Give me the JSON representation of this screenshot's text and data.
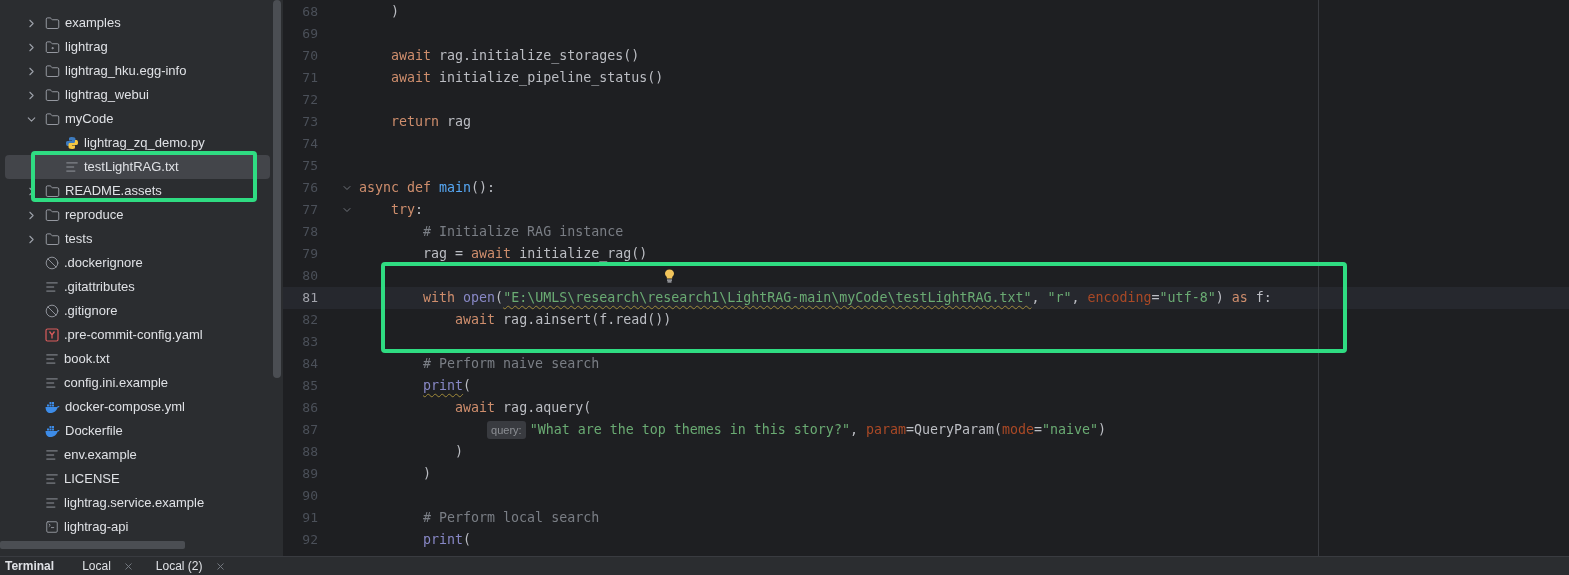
{
  "project_tree": [
    {
      "name": "examples",
      "kind": "folder",
      "expanded": false,
      "selected": false
    },
    {
      "name": "lightrag",
      "kind": "package",
      "expanded": false,
      "selected": false
    },
    {
      "name": "lightrag_hku.egg-info",
      "kind": "folder",
      "expanded": false,
      "selected": false
    },
    {
      "name": "lightrag_webui",
      "kind": "folder",
      "expanded": false,
      "selected": false
    },
    {
      "name": "myCode",
      "kind": "folder",
      "expanded": true,
      "selected": false,
      "children": [
        {
          "name": "lightrag_zq_demo.py",
          "kind": "python",
          "selected": false
        },
        {
          "name": "testLightRAG.txt",
          "kind": "text",
          "selected": true
        }
      ]
    },
    {
      "name": "README.assets",
      "kind": "folder",
      "expanded": false,
      "selected": false
    },
    {
      "name": "reproduce",
      "kind": "folder",
      "expanded": false,
      "selected": false
    },
    {
      "name": "tests",
      "kind": "folder",
      "expanded": false,
      "selected": false
    },
    {
      "name": ".dockerignore",
      "kind": "ignore",
      "selected": false
    },
    {
      "name": ".gitattributes",
      "kind": "text",
      "selected": false
    },
    {
      "name": ".gitignore",
      "kind": "ignore",
      "selected": false
    },
    {
      "name": ".pre-commit-config.yaml",
      "kind": "yaml",
      "selected": false
    },
    {
      "name": "book.txt",
      "kind": "text",
      "selected": false
    },
    {
      "name": "config.ini.example",
      "kind": "text",
      "selected": false
    },
    {
      "name": "docker-compose.yml",
      "kind": "docker",
      "selected": false
    },
    {
      "name": "Dockerfile",
      "kind": "docker",
      "selected": false
    },
    {
      "name": "env.example",
      "kind": "text",
      "selected": false
    },
    {
      "name": "LICENSE",
      "kind": "text",
      "selected": false
    },
    {
      "name": "lightrag.service.example",
      "kind": "text",
      "selected": false
    },
    {
      "name": "lightrag-api",
      "kind": "terminal",
      "selected": false
    }
  ],
  "editor": {
    "lines": [
      {
        "number": "68",
        "current": false,
        "fold": false,
        "bulb": false,
        "tokens": [
          {
            "kind": "plain",
            "text": "    )"
          }
        ]
      },
      {
        "number": "69",
        "current": false,
        "fold": false,
        "bulb": false
      },
      {
        "number": "70",
        "current": false,
        "fold": false,
        "bulb": false,
        "tokens": [
          {
            "kind": "keyword",
            "text": "    await"
          },
          {
            "kind": "plain",
            "text": " rag.initialize_storages()"
          }
        ]
      },
      {
        "number": "71",
        "current": false,
        "fold": false,
        "bulb": false,
        "tokens": [
          {
            "kind": "keyword",
            "text": "    await"
          },
          {
            "kind": "plain",
            "text": " initialize_pipeline_status()"
          }
        ]
      },
      {
        "number": "72",
        "current": false,
        "fold": false,
        "bulb": false
      },
      {
        "number": "73",
        "current": false,
        "fold": false,
        "bulb": false,
        "tokens": [
          {
            "kind": "keyword",
            "text": "    return"
          },
          {
            "kind": "plain",
            "text": " rag"
          }
        ]
      },
      {
        "number": "74",
        "current": false,
        "fold": false,
        "bulb": false
      },
      {
        "number": "75",
        "current": false,
        "fold": false,
        "bulb": false
      },
      {
        "number": "76",
        "current": false,
        "fold": true,
        "bulb": false,
        "tokens": [
          {
            "kind": "keyword",
            "text": "async def "
          },
          {
            "kind": "function",
            "text": "main"
          },
          {
            "kind": "plain",
            "text": "():"
          }
        ]
      },
      {
        "number": "77",
        "current": false,
        "fold": true,
        "bulb": false,
        "tokens": [
          {
            "kind": "keyword",
            "text": "    try"
          },
          {
            "kind": "plain",
            "text": ":"
          }
        ]
      },
      {
        "number": "78",
        "current": false,
        "fold": false,
        "bulb": false,
        "tokens": [
          {
            "kind": "comment",
            "text": "        # Initialize RAG instance"
          }
        ]
      },
      {
        "number": "79",
        "current": false,
        "fold": false,
        "bulb": false,
        "tokens": [
          {
            "kind": "plain",
            "text": "        rag = "
          },
          {
            "kind": "keyword",
            "text": "await"
          },
          {
            "kind": "plain",
            "text": " initialize_rag()"
          }
        ]
      },
      {
        "number": "80",
        "current": false,
        "fold": false,
        "bulb": true
      },
      {
        "number": "81",
        "current": true,
        "fold": false,
        "bulb": false,
        "tokens": [
          {
            "kind": "keyword",
            "text": "        with "
          },
          {
            "kind": "builtin",
            "text": "open"
          },
          {
            "kind": "plain",
            "text": "("
          },
          {
            "kind": "string",
            "text": "\"E:\\UMLS\\research\\research1\\LightRAG-main\\myCode\\testLightRAG.txt\"",
            "warning": true
          },
          {
            "kind": "plain",
            "text": ", "
          },
          {
            "kind": "string",
            "text": "\"r\""
          },
          {
            "kind": "plain",
            "text": ", "
          },
          {
            "kind": "param",
            "text": "encoding"
          },
          {
            "kind": "plain",
            "text": "="
          },
          {
            "kind": "string",
            "text": "\"utf-8\""
          },
          {
            "kind": "plain",
            "text": ") "
          },
          {
            "kind": "keyword",
            "text": "as"
          },
          {
            "kind": "plain",
            "text": " f:"
          }
        ]
      },
      {
        "number": "82",
        "current": false,
        "fold": false,
        "bulb": false,
        "tokens": [
          {
            "kind": "keyword",
            "text": "            await"
          },
          {
            "kind": "plain",
            "text": " rag.ainsert(f.read())"
          }
        ]
      },
      {
        "number": "83",
        "current": false,
        "fold": false,
        "bulb": false
      },
      {
        "number": "84",
        "current": false,
        "fold": false,
        "bulb": false,
        "tokens": [
          {
            "kind": "comment",
            "text": "        # Perform naive search"
          }
        ]
      },
      {
        "number": "85",
        "current": false,
        "fold": false,
        "bulb": false,
        "tokens": [
          {
            "kind": "builtin",
            "text": "        print",
            "warning": true
          },
          {
            "kind": "plain",
            "text": "("
          }
        ]
      },
      {
        "number": "86",
        "current": false,
        "fold": false,
        "bulb": false,
        "tokens": [
          {
            "kind": "keyword",
            "text": "            await"
          },
          {
            "kind": "plain",
            "text": " rag.aquery("
          }
        ]
      },
      {
        "number": "87",
        "current": false,
        "fold": false,
        "bulb": false,
        "tokens": [
          {
            "kind": "hint",
            "text": "                query:"
          },
          {
            "kind": "string",
            "text": "\"What are the top themes in this story?\""
          },
          {
            "kind": "plain",
            "text": ", "
          },
          {
            "kind": "param",
            "text": "param"
          },
          {
            "kind": "plain",
            "text": "=QueryParam("
          },
          {
            "kind": "param",
            "text": "mode"
          },
          {
            "kind": "plain",
            "text": "="
          },
          {
            "kind": "string",
            "text": "\"naive\""
          },
          {
            "kind": "plain",
            "text": ")"
          }
        ]
      },
      {
        "number": "88",
        "current": false,
        "fold": false,
        "bulb": false,
        "tokens": [
          {
            "kind": "plain",
            "text": "            )"
          }
        ]
      },
      {
        "number": "89",
        "current": false,
        "fold": false,
        "bulb": false,
        "tokens": [
          {
            "kind": "plain",
            "text": "        )"
          }
        ]
      },
      {
        "number": "90",
        "current": false,
        "fold": false,
        "bulb": false
      },
      {
        "number": "91",
        "current": false,
        "fold": false,
        "bulb": false,
        "tokens": [
          {
            "kind": "comment",
            "text": "        # Perform local search"
          }
        ]
      },
      {
        "number": "92",
        "current": false,
        "fold": false,
        "bulb": false,
        "tokens": [
          {
            "kind": "builtin",
            "text": "        print"
          },
          {
            "kind": "plain",
            "text": "("
          }
        ]
      }
    ]
  },
  "terminal": {
    "title": "Terminal",
    "tabs": [
      {
        "label": "Local"
      },
      {
        "label": "Local (2)"
      }
    ]
  }
}
